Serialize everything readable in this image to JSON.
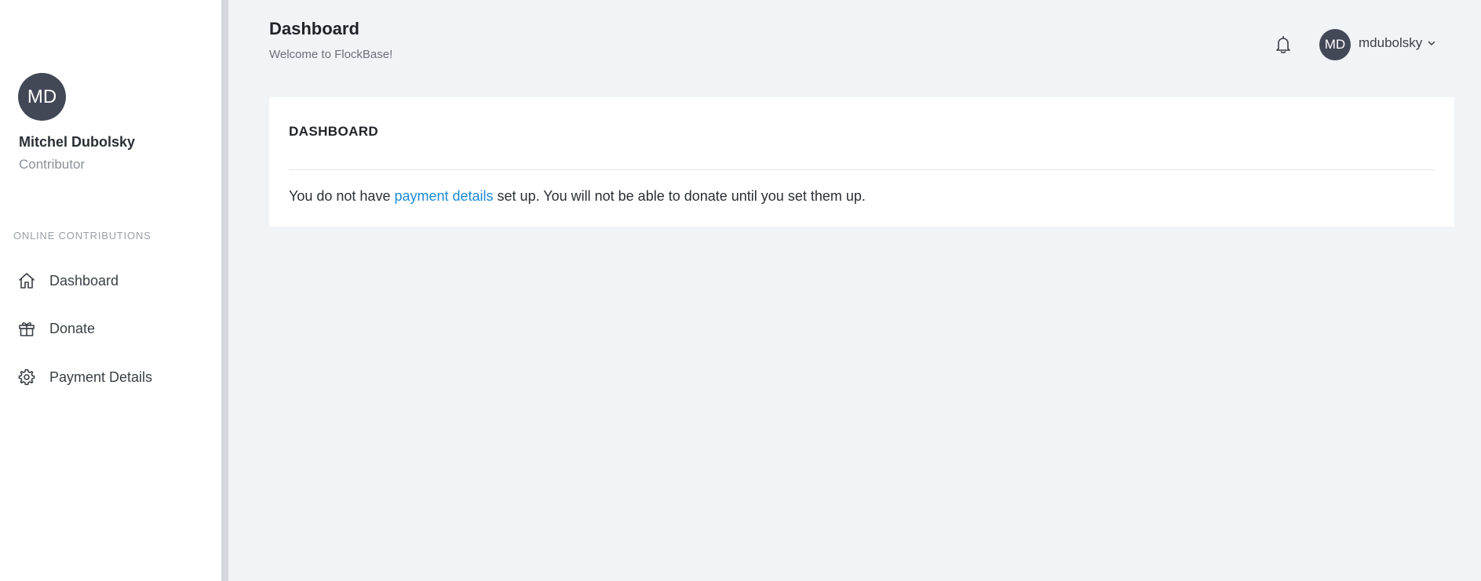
{
  "sidebar": {
    "profile": {
      "initials": "MD",
      "name": "Mitchel Dubolsky",
      "role": "Contributor"
    },
    "section_label": "ONLINE CONTRIBUTIONS",
    "items": [
      {
        "label": "Dashboard",
        "icon": "home-icon"
      },
      {
        "label": "Donate",
        "icon": "gift-icon"
      },
      {
        "label": "Payment Details",
        "icon": "gear-icon"
      }
    ]
  },
  "header": {
    "title": "Dashboard",
    "subtitle": "Welcome to FlockBase!",
    "notifications_icon": "bell-icon",
    "user": {
      "initials": "MD",
      "username": "mdubolsky"
    }
  },
  "card": {
    "title": "DASHBOARD",
    "message_before": "You do not have ",
    "message_link": "payment details",
    "message_after": " set up. You will not be able to donate until you set them up."
  },
  "colors": {
    "avatar_bg": "#434857",
    "link": "#1b8bd6",
    "background": "#f1f4f7"
  }
}
